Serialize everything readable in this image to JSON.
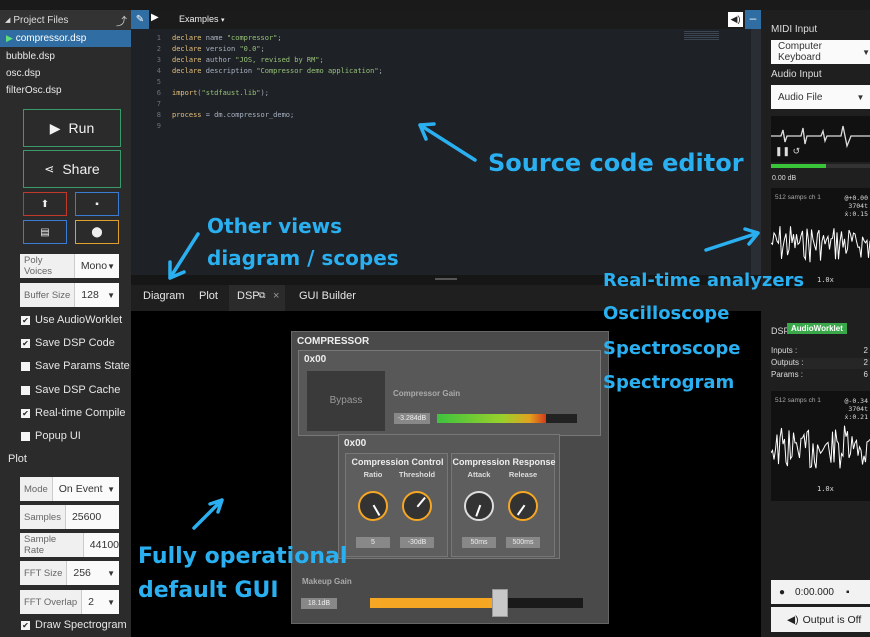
{
  "sidebar": {
    "header": "Project Files",
    "files": [
      "compressor.dsp",
      "bubble.dsp",
      "osc.dsp",
      "filterOsc.dsp"
    ],
    "run_label": "Run",
    "share_label": "Share",
    "poly": {
      "label": "Poly Voices",
      "value": "Mono"
    },
    "buffer": {
      "label": "Buffer Size",
      "value": "128"
    },
    "checks": [
      {
        "label": "Use AudioWorklet",
        "checked": true
      },
      {
        "label": "Save DSP Code",
        "checked": true
      },
      {
        "label": "Save Params State",
        "checked": false
      },
      {
        "label": "Save DSP Cache",
        "checked": false
      },
      {
        "label": "Real-time Compile",
        "checked": true
      },
      {
        "label": "Popup UI",
        "checked": false
      }
    ],
    "plot_header": "Plot",
    "mode": {
      "label": "Mode",
      "value": "On Event"
    },
    "samples": {
      "label": "Samples",
      "value": "25600"
    },
    "samplerate": {
      "label": "Sample Rate",
      "value": "44100"
    },
    "fftsize": {
      "label": "FFT Size",
      "value": "256"
    },
    "fftoverlap": {
      "label": "FFT Overlap",
      "value": "2"
    },
    "draw": {
      "label": "Draw Spectrogram",
      "checked": true
    }
  },
  "toolbar": {
    "examples": "Examples"
  },
  "editor": {
    "lines": [
      {
        "n": "1",
        "t": "declare name \"compressor\";"
      },
      {
        "n": "2",
        "t": "declare version \"0.0\";"
      },
      {
        "n": "3",
        "t": "declare author \"JOS, revised by RM\";"
      },
      {
        "n": "4",
        "t": "declare description \"Compressor demo application\";"
      },
      {
        "n": "5",
        "t": ""
      },
      {
        "n": "6",
        "t": "import(\"stdfaust.lib\");"
      },
      {
        "n": "7",
        "t": ""
      },
      {
        "n": "8",
        "t": "process = dm.compressor_demo;"
      },
      {
        "n": "9",
        "t": ""
      }
    ]
  },
  "tabs": {
    "diagram": "Diagram",
    "plot": "Plot",
    "dsp": "DSP",
    "close": "×",
    "gui": "GUI Builder"
  },
  "gui": {
    "title": "COMPRESSOR",
    "group1": "0x00",
    "bypass": "Bypass",
    "gain_label": "Compressor Gain",
    "gain_value": "-3.284dB",
    "gain_level": 0.78,
    "group2": "0x00",
    "cc_title": "Compression Control",
    "cr_title": "Compression Response",
    "knobs": [
      {
        "label": "Ratio",
        "value": "5"
      },
      {
        "label": "Threshold",
        "value": "-30dB"
      },
      {
        "label": "Attack",
        "value": "50ms"
      },
      {
        "label": "Release",
        "value": "500ms"
      }
    ],
    "makeup_label": "Makeup Gain",
    "makeup_value": "18.1dB",
    "makeup_level": 0.6
  },
  "right": {
    "midi_label": "MIDI Input",
    "midi_value": "Computer Keyboard",
    "audio_label": "Audio Input",
    "audio_value": "Audio File",
    "db": "0.00 dB",
    "scope1": "512 samps ch 1",
    "scope1_readout": [
      "@+0.00",
      "3704t",
      "ẋ:0.15"
    ],
    "zoom": "1.0x",
    "dsp_label": "DSP",
    "worklet": "AudioWorklet",
    "stats": [
      {
        "k": "Inputs :",
        "v": "2"
      },
      {
        "k": "Outputs :",
        "v": "2"
      },
      {
        "k": "Params :",
        "v": "6"
      }
    ],
    "scope2": "512 samps ch 1",
    "scope2_readout": [
      "@-0.34",
      "3704t",
      "ẋ:0.21"
    ],
    "zoom2": "1.0x",
    "time": "0:00.000",
    "output": "Output is Off"
  },
  "annotations": {
    "editor": "Source code editor",
    "views1": "Other views",
    "views2": "diagram / scopes",
    "analyzers": [
      "Real-time analyzers",
      "Oscilloscope",
      "Spectroscope",
      "Spectrogram"
    ],
    "gui1": "Fully operational",
    "gui2": "default GUI"
  },
  "colors": {
    "annotation": "#2ab0f0",
    "accent": "#2f6da3",
    "meter": "#39c43a",
    "orange": "#f5a623"
  }
}
